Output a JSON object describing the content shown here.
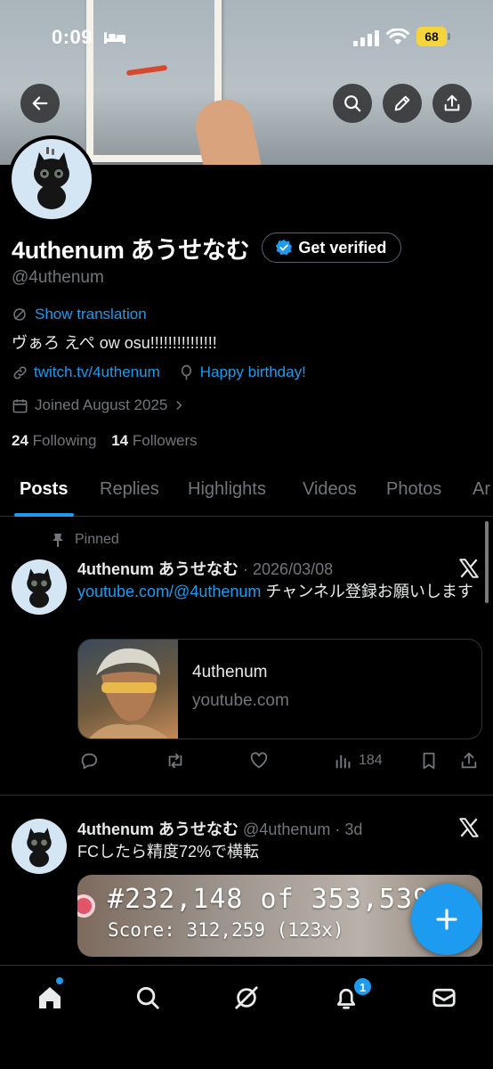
{
  "status_bar": {
    "time": "0:09",
    "battery": "68"
  },
  "profile": {
    "display_name": "4uthenum あうせなむ",
    "verify_label": "Get verified",
    "handle": "@4uthenum",
    "show_translation": "Show translation",
    "bio": "ヴぁろ えぺ ow osu!!!!!!!!!!!!!!!",
    "link": "twitch.tv/4uthenum",
    "birthday": "Happy birthday!",
    "joined": "Joined August 2025",
    "following_count": "24",
    "following_label": "Following",
    "followers_count": "14",
    "followers_label": "Followers"
  },
  "tabs": [
    {
      "label": "Posts",
      "active": true
    },
    {
      "label": "Replies"
    },
    {
      "label": "Highlights"
    },
    {
      "label": "Videos"
    },
    {
      "label": "Photos"
    },
    {
      "label": "Ar"
    }
  ],
  "posts": [
    {
      "pinned_label": "Pinned",
      "name": "4uthenum あうせなむ",
      "meta": "· 2026/03/08",
      "link_text": "youtube.com/@4uthenum",
      "text": " チャンネル登録お願いします",
      "card": {
        "title": "4uthenum",
        "domain": "youtube.com"
      },
      "views": "184"
    },
    {
      "name": "4uthenum あうせなむ",
      "meta": "@4uthenum · 3d",
      "text": "FCしたら精度72%で横転",
      "media": {
        "rank": "#232,148 of 353,539",
        "score": "Score: 312,259 (123x)"
      }
    }
  ],
  "nav": {
    "notification_count": "1"
  },
  "colors": {
    "accent": "#1d9bf0",
    "secondary_text": "#71767b",
    "battery": "#f6d53c"
  }
}
